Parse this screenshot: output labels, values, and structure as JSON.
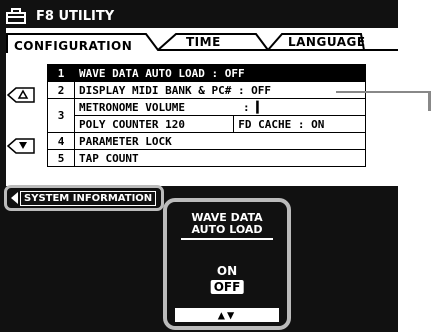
{
  "header": {
    "title": "F8 UTILITY",
    "icon": "utility-icon"
  },
  "tabs": [
    {
      "label": "CONFIGURATION"
    },
    {
      "label": "TIME"
    },
    {
      "label": "LANGUAGE"
    }
  ],
  "menu": {
    "items": [
      {
        "num": "1",
        "label": "WAVE DATA AUTO LOAD : OFF"
      },
      {
        "num": "2",
        "label": "DISPLAY MIDI BANK & PC#   : OFF"
      },
      {
        "num": "3",
        "label": "METRONOME VOLUME",
        "value": ":  ▍",
        "sub1": "POLY COUNTER 120",
        "sub2": "FD CACHE : ON"
      },
      {
        "num": "4",
        "label": "PARAMETER LOCK"
      },
      {
        "num": "5",
        "label": "TAP COUNT"
      }
    ]
  },
  "system_info": {
    "label": "SYSTEM INFORMATION"
  },
  "popup": {
    "title_line1": "WAVE DATA",
    "title_line2": "AUTO LOAD",
    "on_label": "ON",
    "off_label": "OFF",
    "arrows": "▲▼"
  }
}
